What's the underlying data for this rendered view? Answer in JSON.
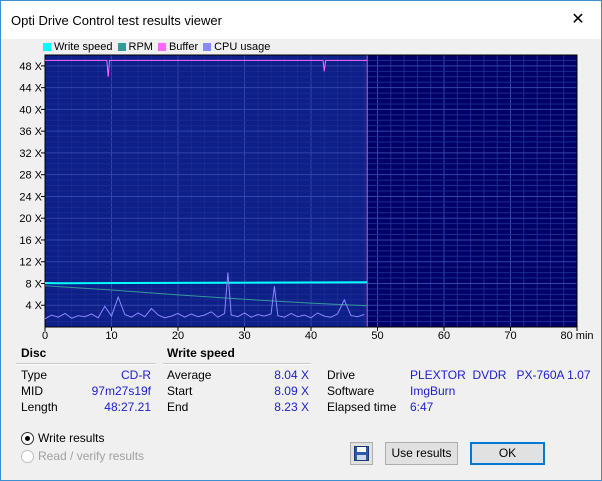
{
  "window": {
    "title": "Opti Drive Control test results viewer"
  },
  "legend": [
    {
      "label": "Write speed",
      "color": "#00ffff"
    },
    {
      "label": "RPM",
      "color": "#339999"
    },
    {
      "label": "Buffer",
      "color": "#ff66ff"
    },
    {
      "label": "CPU usage",
      "color": "#8888ff"
    }
  ],
  "chart_data": {
    "type": "line",
    "x_unit": "min",
    "xlim": [
      0,
      80
    ],
    "ylim": [
      0,
      50
    ],
    "x_ticks": [
      "0",
      "10",
      "20",
      "30",
      "40",
      "50",
      "60",
      "70",
      "80 min"
    ],
    "y_ticks": [
      "4 X",
      "8 X",
      "12 X",
      "16 X",
      "20 X",
      "24 X",
      "28 X",
      "32 X",
      "36 X",
      "40 X",
      "44 X",
      "48 X"
    ],
    "y_tick_values": [
      4,
      8,
      12,
      16,
      20,
      24,
      28,
      32,
      36,
      40,
      44,
      48
    ],
    "end_time": 48.45,
    "series": [
      {
        "name": "Write speed",
        "color": "#00ffff",
        "x": [
          0,
          2,
          48.45
        ],
        "y": [
          8.09,
          8.05,
          8.23
        ]
      },
      {
        "name": "RPM",
        "color": "#339999",
        "x": [
          0,
          10,
          20,
          30,
          40,
          48.45
        ],
        "y": [
          7.6,
          6.8,
          5.9,
          5.1,
          4.4,
          3.9
        ]
      },
      {
        "name": "Buffer",
        "color": "#ff66ff",
        "x": [
          0,
          9.3,
          9.5,
          9.7,
          41.8,
          42.0,
          42.2,
          48.45
        ],
        "y": [
          49,
          49,
          46,
          49,
          49,
          47,
          49,
          49
        ]
      },
      {
        "name": "CPU usage",
        "color": "#8888ff",
        "x": [
          0,
          1,
          2,
          3,
          4,
          5,
          6,
          7,
          8,
          9,
          10,
          11,
          12,
          13,
          14,
          15,
          16,
          17,
          18,
          19,
          20,
          21,
          22,
          23,
          24,
          25,
          26,
          27,
          27.5,
          28,
          29,
          30,
          31,
          32,
          33,
          34,
          34.5,
          35,
          36,
          37,
          38,
          39,
          40,
          41,
          42,
          43,
          44,
          45,
          46,
          47,
          48
        ],
        "y": [
          1.5,
          2.2,
          1.8,
          2.5,
          1.6,
          2.1,
          1.9,
          2.4,
          1.7,
          3.8,
          2.0,
          5.5,
          2.3,
          1.8,
          2.6,
          1.9,
          3.4,
          2.2,
          1.7,
          2.0,
          2.5,
          1.8,
          2.4,
          1.9,
          2.2,
          2.8,
          1.8,
          2.5,
          10.0,
          2.2,
          1.9,
          2.6,
          1.8,
          2.3,
          2.0,
          2.4,
          7.5,
          2.1,
          1.8,
          2.5,
          1.9,
          2.2,
          1.7,
          2.6,
          2.0,
          1.8,
          2.4,
          5.0,
          2.1,
          1.9,
          2.3
        ]
      }
    ]
  },
  "disc": {
    "header": "Disc",
    "type_label": "Type",
    "type_value": "CD-R",
    "mid_label": "MID",
    "mid_value": "97m27s19f",
    "length_label": "Length",
    "length_value": "48:27.21"
  },
  "write_speed": {
    "header": "Write speed",
    "average_label": "Average",
    "average_value": "8.04 X",
    "start_label": "Start",
    "start_value": "8.09 X",
    "end_label": "End",
    "end_value": "8.23 X"
  },
  "drive_info": {
    "drive_label": "Drive",
    "drive_value": "PLEXTOR  DVDR   PX-760A 1.07",
    "software_label": "Software",
    "software_value": "ImgBurn",
    "elapsed_label": "Elapsed time",
    "elapsed_value": "6:47"
  },
  "options": {
    "write_results": "Write results",
    "read_verify_results": "Read / verify results"
  },
  "buttons": {
    "save_icon": "floppy-disk-icon",
    "use_results": "Use results",
    "ok": "OK"
  }
}
